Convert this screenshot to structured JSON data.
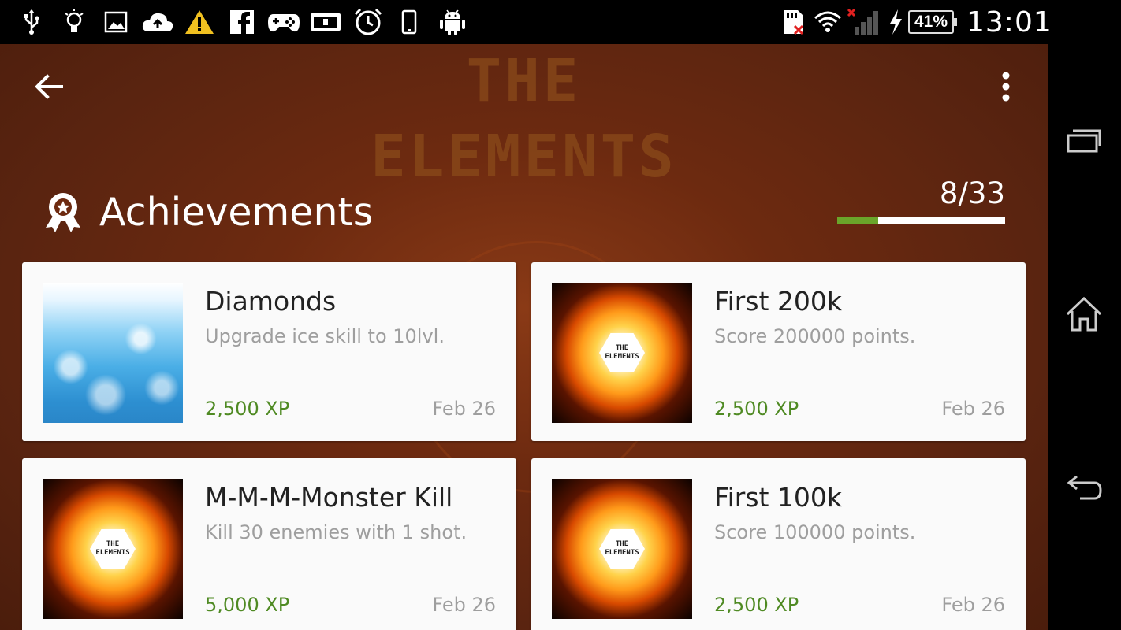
{
  "status_bar": {
    "left_icons": [
      "usb-icon",
      "lightbulb-icon",
      "image-icon",
      "cloud-upload-icon",
      "warning-icon",
      "facebook-icon",
      "gamepad-icon",
      "id-card-icon",
      "alarm-icon",
      "phone-icon",
      "android-icon"
    ],
    "right_icons": [
      "sd-card-error-icon",
      "wifi-icon",
      "signal-icon",
      "charging-icon"
    ],
    "battery": "41%",
    "time": "13:01"
  },
  "app": {
    "background_title_line1": "THE",
    "background_title_line2": "ELEMENTS",
    "header": {
      "title": "Achievements",
      "progress_text": "8/33",
      "progress_fraction": 0.2424
    },
    "achievements": [
      {
        "title": "Diamonds",
        "description": "Upgrade ice skill to 10lvl.",
        "xp": "2,500 XP",
        "date": "Feb 26",
        "image": "ice"
      },
      {
        "title": "First 200k",
        "description": "Score 200000 points.",
        "xp": "2,500 XP",
        "date": "Feb 26",
        "image": "fire"
      },
      {
        "title": "M-M-M-Monster Kill",
        "description": "Kill 30 enemies with 1 shot.",
        "xp": "5,000 XP",
        "date": "Feb 26",
        "image": "fire"
      },
      {
        "title": "First 100k",
        "description": "Score 100000 points.",
        "xp": "2,500 XP",
        "date": "Feb 26",
        "image": "fire"
      }
    ],
    "game_logo_text": {
      "line1": "THE",
      "line2": "ELEMENTS"
    }
  },
  "colors": {
    "xp_green": "#4f8a23",
    "progress_green": "#6aa52a",
    "background_brown": "#5a2410"
  }
}
